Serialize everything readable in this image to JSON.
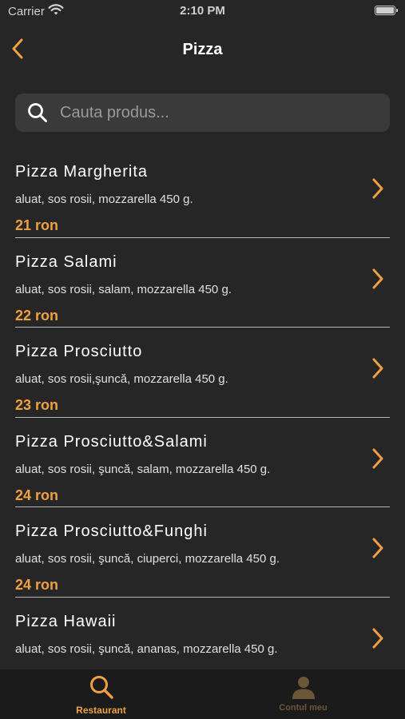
{
  "status_bar": {
    "carrier": "Carrier",
    "time": "2:10 PM"
  },
  "nav": {
    "title": "Pizza",
    "back_icon": "chevron-left-icon"
  },
  "search": {
    "placeholder": "Cauta produs...",
    "value": ""
  },
  "products": [
    {
      "name": "Pizza Margherita",
      "description": "aluat, sos rosii, mozzarella 450 g.",
      "price": "21 ron"
    },
    {
      "name": "Pizza Salami",
      "description": "aluat, sos rosii, salam, mozzarella 450 g.",
      "price": "22 ron"
    },
    {
      "name": "Pizza Prosciutto",
      "description": "aluat, sos rosii,şuncă, mozzarella 450 g.",
      "price": "23 ron"
    },
    {
      "name": "Pizza Prosciutto&Salami",
      "description": "aluat, sos rosii, şuncă, salam, mozzarella 450 g.",
      "price": "24 ron"
    },
    {
      "name": "Pizza Prosciutto&Funghi",
      "description": "aluat, sos rosii, şuncă, ciuperci, mozzarella 450 g.",
      "price": "24 ron"
    },
    {
      "name": "Pizza Hawaii",
      "description": "aluat, sos rosii, şuncă, ananas, mozzarella 450 g.",
      "price": ""
    }
  ],
  "tab_bar": {
    "tabs": [
      {
        "label": "Restaurant",
        "icon": "search-icon",
        "active": true
      },
      {
        "label": "Contul meu",
        "icon": "person-icon",
        "active": false
      }
    ]
  },
  "colors": {
    "accent": "#f0a040",
    "background": "#262626",
    "search_bg": "#3a3a3a",
    "tab_bar_bg": "#1b1b1b",
    "inactive_tab": "#6b5638"
  }
}
